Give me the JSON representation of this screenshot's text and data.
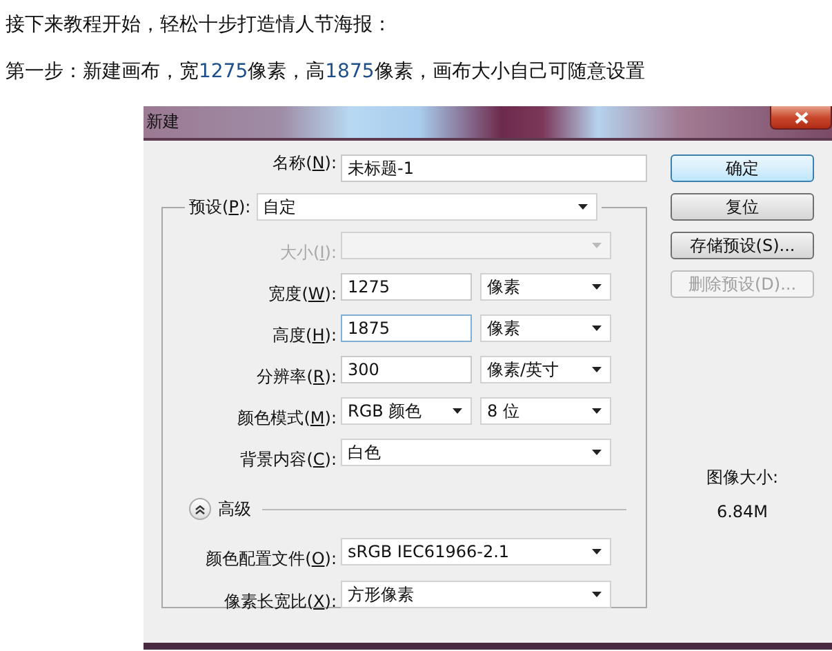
{
  "article": {
    "lines": [
      {
        "segments": [
          {
            "text": "接下来教程开始，轻松十步打造情人节海报：",
            "highlight": false
          }
        ]
      },
      {
        "segments": [
          {
            "text": "第一步：新建画布，宽",
            "highlight": false
          },
          {
            "text": "1275",
            "highlight": true
          },
          {
            "text": "像素，高",
            "highlight": false
          },
          {
            "text": "1875",
            "highlight": true
          },
          {
            "text": "像素，画布大小自己可随意设置",
            "highlight": false
          }
        ]
      }
    ]
  },
  "dialog": {
    "title": "新建",
    "name_row": {
      "label": [
        "名称(",
        "N",
        "):"
      ],
      "controls": [
        {
          "kind": "input",
          "value": "未标题-1",
          "focused": false
        }
      ]
    },
    "preset_row": {
      "label": [
        "预设(",
        "P",
        "):"
      ],
      "controls": [
        {
          "kind": "select",
          "value": "自定",
          "disabled": false
        }
      ]
    },
    "rows": [
      {
        "label": [
          "大小(",
          "I",
          "):"
        ],
        "disabled": true,
        "controls": [
          {
            "kind": "select",
            "disabled": true
          }
        ]
      },
      {
        "label": [
          "宽度(",
          "W",
          "):"
        ],
        "disabled": false,
        "controls": [
          {
            "kind": "input",
            "value": "1275",
            "focused": false
          },
          {
            "kind": "select",
            "value": "像素",
            "disabled": false
          }
        ]
      },
      {
        "label": [
          "高度(",
          "H",
          "):"
        ],
        "disabled": false,
        "controls": [
          {
            "kind": "input",
            "value": "1875",
            "focused": true
          },
          {
            "kind": "select",
            "value": "像素",
            "disabled": false
          }
        ]
      },
      {
        "label": [
          "分辨率(",
          "R",
          "):"
        ],
        "disabled": false,
        "controls": [
          {
            "kind": "input",
            "value": "300",
            "focused": false
          },
          {
            "kind": "select",
            "value": "像素/英寸",
            "disabled": false
          }
        ]
      },
      {
        "label": [
          "颜色模式(",
          "M",
          "):"
        ],
        "disabled": false,
        "controls": [
          {
            "kind": "select",
            "value": "RGB 颜色",
            "disabled": false
          },
          {
            "kind": "select",
            "value": "8 位",
            "disabled": false
          }
        ]
      },
      {
        "label": [
          "背景内容(",
          "C",
          "):"
        ],
        "disabled": false,
        "controls": [
          {
            "kind": "select",
            "value": "白色",
            "disabled": false
          }
        ]
      }
    ],
    "advanced": {
      "label": "高级",
      "expanded": true
    },
    "advanced_rows": [
      {
        "label": [
          "颜色配置文件(",
          "O",
          "):"
        ],
        "disabled": false,
        "controls": [
          {
            "kind": "select",
            "value": "sRGB IEC61966-2.1",
            "disabled": false
          }
        ]
      },
      {
        "label": [
          "像素长宽比(",
          "X",
          "):"
        ],
        "disabled": false,
        "controls": [
          {
            "kind": "select",
            "value": "方形像素",
            "disabled": false
          }
        ]
      }
    ],
    "buttons": [
      {
        "label": "确定",
        "default": true,
        "disabled": false
      },
      {
        "label": "复位",
        "default": false,
        "disabled": false
      },
      {
        "label": "存储预设(S)...",
        "default": false,
        "disabled": false
      },
      {
        "label": "删除预设(D)...",
        "default": false,
        "disabled": true
      }
    ],
    "image_size": {
      "label": "图像大小:",
      "value": "6.84M"
    }
  }
}
